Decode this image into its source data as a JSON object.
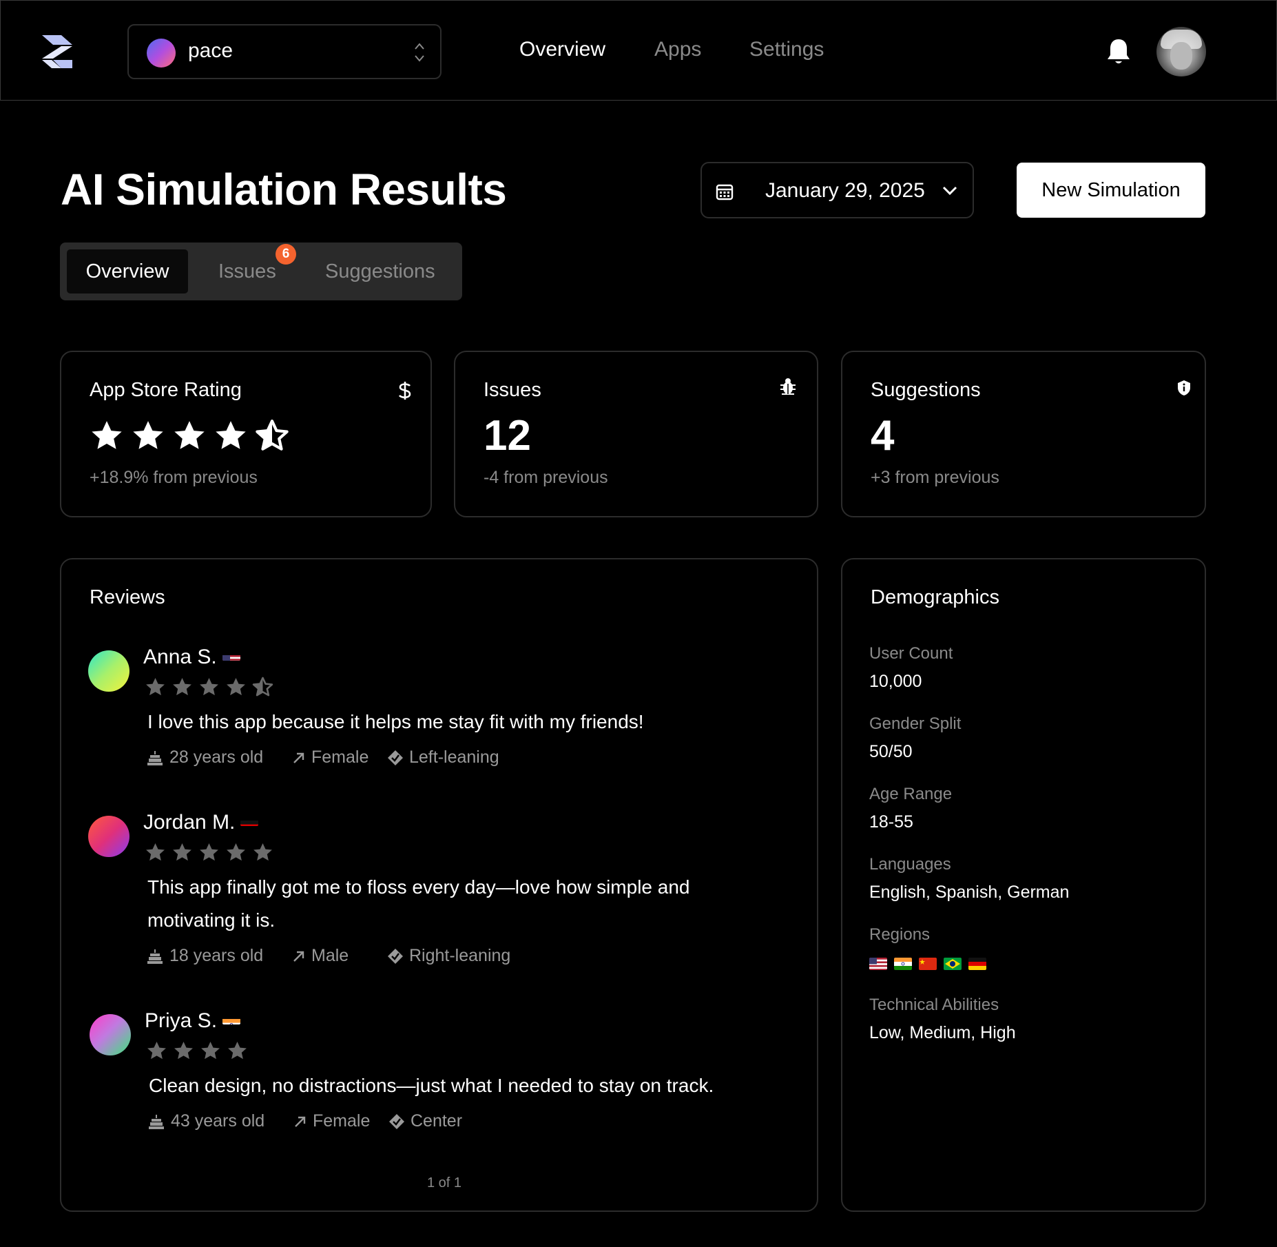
{
  "nav": {
    "org_name": "pace",
    "links": [
      "Overview",
      "Apps",
      "Settings"
    ]
  },
  "header": {
    "title": "AI Simulation Results",
    "date": "January 29, 2025",
    "new_button": "New Simulation"
  },
  "tabs": {
    "items": [
      "Overview",
      "Issues",
      "Suggestions"
    ],
    "issues_badge": "6"
  },
  "stats": {
    "rating": {
      "title": "App Store Rating",
      "stars": 4.5,
      "delta": "+18.9% from previous",
      "icon": "dollar-icon"
    },
    "issues": {
      "title": "Issues",
      "value": "12",
      "delta": "-4 from previous",
      "icon": "bug-icon"
    },
    "suggestions": {
      "title": "Suggestions",
      "value": "4",
      "delta": "+3 from previous",
      "icon": "shield-icon"
    }
  },
  "reviews": {
    "title": "Reviews",
    "items": [
      {
        "name": "Anna S.",
        "country": "US",
        "rating": 4.5,
        "text_lines": [
          "I love this app because it helps me stay fit with my friends!"
        ],
        "age": "28 years old",
        "gender": "Female",
        "politics": "Left-leaning"
      },
      {
        "name": "Jordan M.",
        "country": "DE",
        "rating": 5,
        "text_lines": [
          "This app finally got me to floss every day—love how simple and",
          "motivating it is."
        ],
        "age": "18 years old",
        "gender": "Male",
        "politics": "Right-leaning"
      },
      {
        "name": "Priya S.",
        "country": "IN",
        "rating": 4,
        "text_lines": [
          "Clean design, no distractions—just what I needed to stay on track."
        ],
        "age": "43 years old",
        "gender": "Female",
        "politics": "Center"
      }
    ],
    "pager": "1 of 1"
  },
  "demographics": {
    "title": "Demographics",
    "user_count_label": "User Count",
    "user_count": "10,000",
    "gender_split_label": "Gender Split",
    "gender_split": "50/50",
    "age_range_label": "Age Range",
    "age_range": "18-55",
    "languages_label": "Languages",
    "languages": "English, Spanish, German",
    "regions_label": "Regions",
    "regions": [
      "US",
      "IN",
      "CN",
      "BR",
      "DE"
    ],
    "tech_label": "Technical Abilities",
    "tech": "Low, Medium, High"
  },
  "colors": {
    "accent_badge": "#f4632e",
    "muted": "#8a8a8a",
    "border": "#2c2c2c"
  }
}
